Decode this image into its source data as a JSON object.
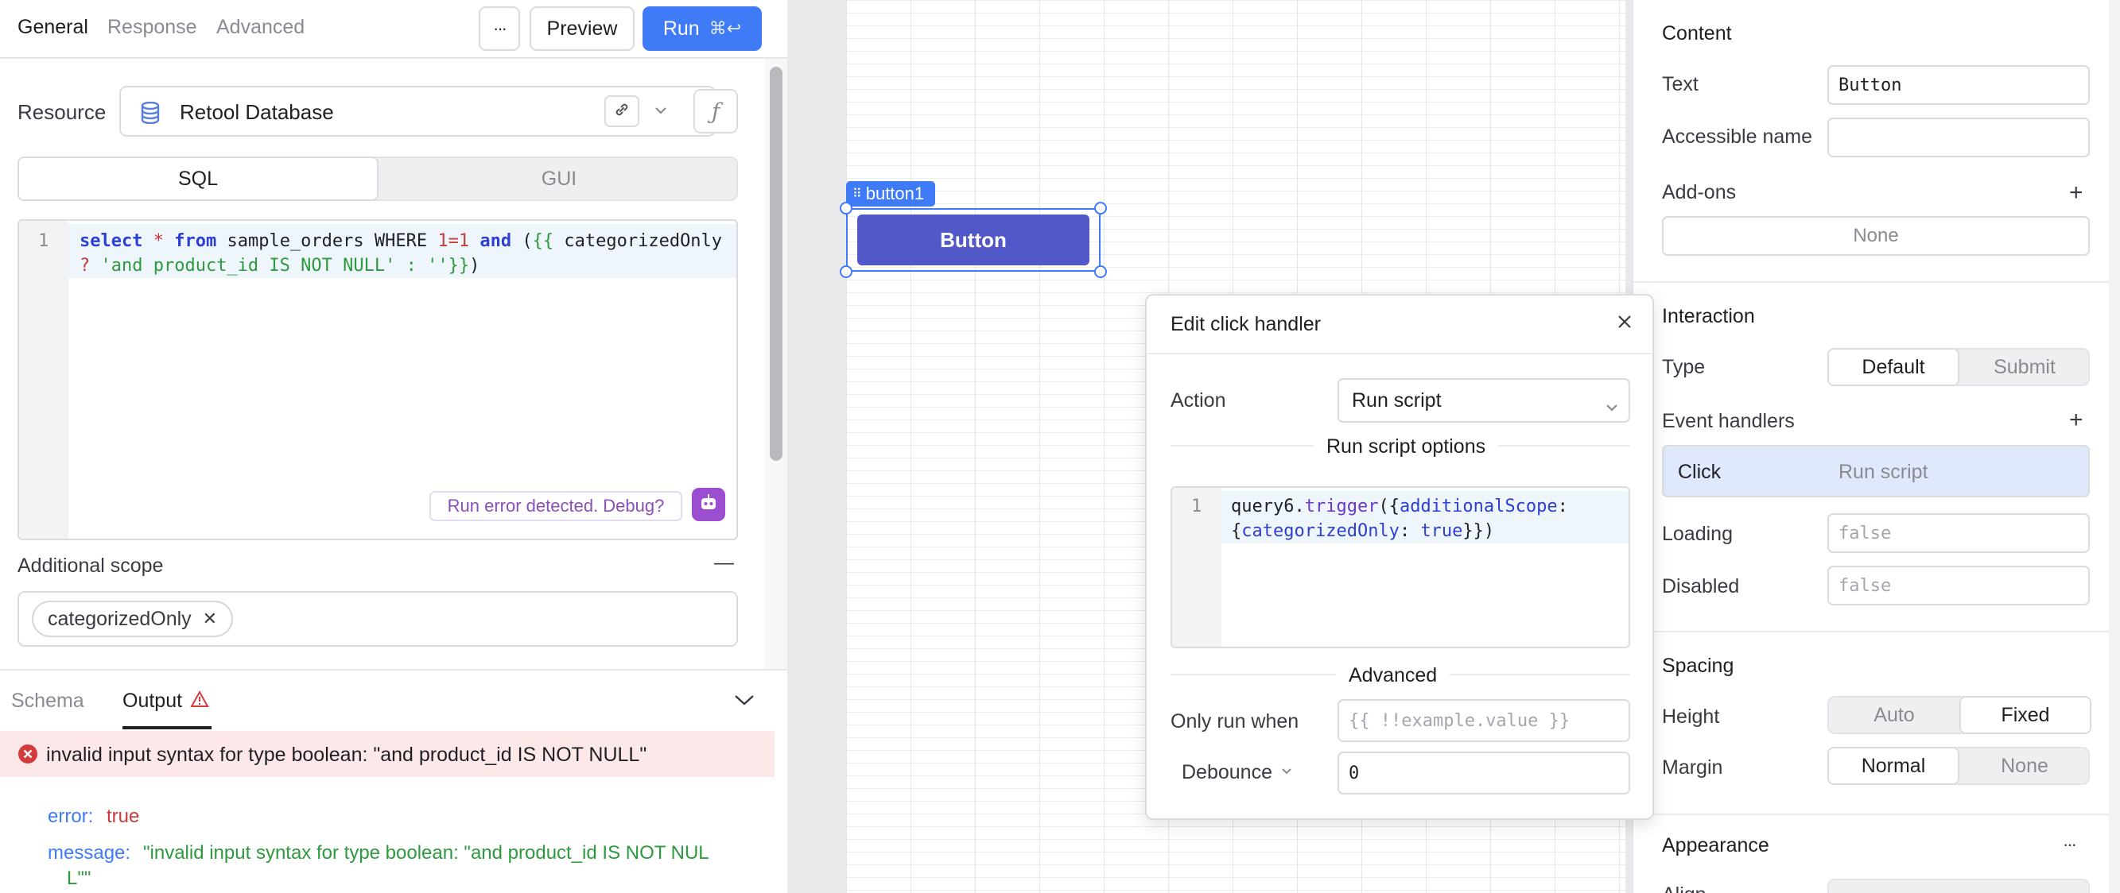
{
  "query_editor": {
    "tabs": [
      {
        "label": "General"
      },
      {
        "label": "Response"
      },
      {
        "label": "Advanced"
      }
    ],
    "more_label": "···",
    "preview_label": "Preview",
    "run_label": "Run",
    "run_shortcut": "⌘↩",
    "resource_label": "Resource",
    "resource_value": "Retool Database",
    "mode_options": [
      "SQL",
      "GUI"
    ],
    "selected_mode": "SQL",
    "sql_line_number": "1",
    "sql": {
      "p1": "select",
      "p2": " * ",
      "p3": "from",
      "p4": " sample_orders WHERE ",
      "p5": "1",
      "p6": "=",
      "p7": "1",
      "p8": " ",
      "p9": "and",
      "p10": " (",
      "p11": "{{",
      "p12": " categorizedOnly",
      "p13": "? ",
      "p14": "'and product_id IS NOT NULL'",
      "p15": " : ",
      "p16": "''",
      "p17": "}}",
      "p18": ")"
    },
    "debug_hint": "Run error detected. Debug?",
    "additional_scope_label": "Additional scope",
    "scope_pill": "categorizedOnly",
    "scope_pill_remove": "✕",
    "collapse_label": "—"
  },
  "output_panel": {
    "tabs": [
      {
        "label": "Schema"
      },
      {
        "label": "Output"
      }
    ],
    "active_tab": "Output",
    "error_message": "invalid input syntax for type boolean: \"and product_id IS NOT NULL\"",
    "result": {
      "error_key": "error:",
      "error_value": "true",
      "message_key": "message:",
      "message_line1": "\"invalid input syntax for type boolean: \"and product_id IS NOT NUL",
      "message_line2": "L\"\""
    }
  },
  "canvas": {
    "component_tag": "button1",
    "button_text": "Button"
  },
  "popover": {
    "title": "Edit click handler",
    "action_label": "Action",
    "action_value": "Run script",
    "run_script_options_label": "Run script options",
    "code_line_number": "1",
    "code": {
      "c1": "query6",
      "c2": ".",
      "c3": "trigger",
      "c4": "({",
      "c5": "additionalScope",
      "c6": ":",
      "c7": "{",
      "c8": "categorizedOnly",
      "c9": ": ",
      "c10": "true",
      "c11": "}})"
    },
    "advanced_label": "Advanced",
    "only_run_when_label": "Only run when",
    "only_run_when_placeholder": "{{ !!example.value }}",
    "debounce_label": "Debounce",
    "debounce_value": "0"
  },
  "inspector": {
    "content": {
      "title": "Content",
      "text_label": "Text",
      "text_value": "Button",
      "accessible_name_label": "Accessible name",
      "accessible_name_value": "",
      "addons_label": "Add-ons",
      "addons_value": "None"
    },
    "interaction": {
      "title": "Interaction",
      "type_label": "Type",
      "type_options": [
        "Default",
        "Submit"
      ],
      "selected_type": "Default",
      "event_handlers_label": "Event handlers",
      "handler_event": "Click",
      "handler_action": "Run script",
      "loading_label": "Loading",
      "loading_value": "false",
      "disabled_label": "Disabled",
      "disabled_value": "false"
    },
    "spacing": {
      "title": "Spacing",
      "height_label": "Height",
      "height_options": [
        "Auto",
        "Fixed"
      ],
      "selected_height": "Fixed",
      "margin_label": "Margin",
      "margin_options": [
        "Normal",
        "None"
      ],
      "selected_margin": "Normal"
    },
    "appearance": {
      "title": "Appearance",
      "more_label": "···",
      "align_label": "Align"
    }
  },
  "colors": {
    "accent_blue": "#3f7bf6",
    "button_indigo": "#5258c8",
    "error_red": "#d63b3b",
    "handler_highlight": "#dfe9fb"
  }
}
